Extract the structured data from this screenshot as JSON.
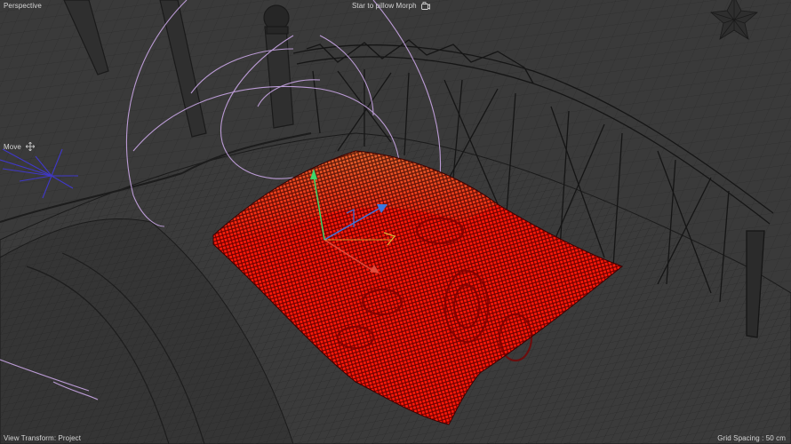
{
  "viewport": {
    "camera_label": "Perspective",
    "scene_title": "Star to pillow Morph",
    "tool_label": "Move",
    "view_transform": "View Transform: Project",
    "grid_spacing": "Grid Spacing : 50 cm"
  },
  "icons": {
    "camera": "camera-icon",
    "move": "move-arrows-icon"
  },
  "colors": {
    "background": "#393939",
    "wireframe": "#1c1c1c",
    "pillow_points": "#ff1a0a",
    "pillow_points_warm": "#d88a4a",
    "spline_paths": "#c9a6e6",
    "star_object": "#4038c8",
    "axis_x": "#e04a3a",
    "axis_y": "#3ed66a",
    "axis_z": "#3a78e0",
    "hud_text": "#d6d6d6"
  }
}
